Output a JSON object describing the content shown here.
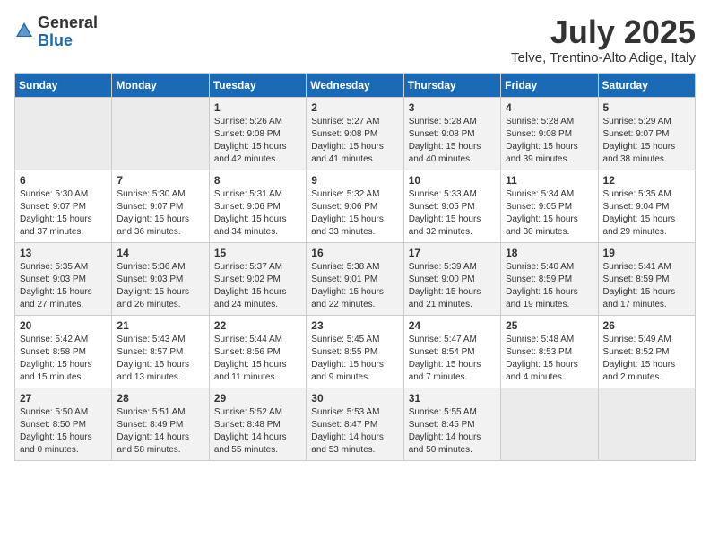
{
  "logo": {
    "text_general": "General",
    "text_blue": "Blue"
  },
  "header": {
    "month": "July 2025",
    "location": "Telve, Trentino-Alto Adige, Italy"
  },
  "weekdays": [
    "Sunday",
    "Monday",
    "Tuesday",
    "Wednesday",
    "Thursday",
    "Friday",
    "Saturday"
  ],
  "weeks": [
    [
      {
        "day": "",
        "info": ""
      },
      {
        "day": "",
        "info": ""
      },
      {
        "day": "1",
        "info": "Sunrise: 5:26 AM\nSunset: 9:08 PM\nDaylight: 15 hours\nand 42 minutes."
      },
      {
        "day": "2",
        "info": "Sunrise: 5:27 AM\nSunset: 9:08 PM\nDaylight: 15 hours\nand 41 minutes."
      },
      {
        "day": "3",
        "info": "Sunrise: 5:28 AM\nSunset: 9:08 PM\nDaylight: 15 hours\nand 40 minutes."
      },
      {
        "day": "4",
        "info": "Sunrise: 5:28 AM\nSunset: 9:08 PM\nDaylight: 15 hours\nand 39 minutes."
      },
      {
        "day": "5",
        "info": "Sunrise: 5:29 AM\nSunset: 9:07 PM\nDaylight: 15 hours\nand 38 minutes."
      }
    ],
    [
      {
        "day": "6",
        "info": "Sunrise: 5:30 AM\nSunset: 9:07 PM\nDaylight: 15 hours\nand 37 minutes."
      },
      {
        "day": "7",
        "info": "Sunrise: 5:30 AM\nSunset: 9:07 PM\nDaylight: 15 hours\nand 36 minutes."
      },
      {
        "day": "8",
        "info": "Sunrise: 5:31 AM\nSunset: 9:06 PM\nDaylight: 15 hours\nand 34 minutes."
      },
      {
        "day": "9",
        "info": "Sunrise: 5:32 AM\nSunset: 9:06 PM\nDaylight: 15 hours\nand 33 minutes."
      },
      {
        "day": "10",
        "info": "Sunrise: 5:33 AM\nSunset: 9:05 PM\nDaylight: 15 hours\nand 32 minutes."
      },
      {
        "day": "11",
        "info": "Sunrise: 5:34 AM\nSunset: 9:05 PM\nDaylight: 15 hours\nand 30 minutes."
      },
      {
        "day": "12",
        "info": "Sunrise: 5:35 AM\nSunset: 9:04 PM\nDaylight: 15 hours\nand 29 minutes."
      }
    ],
    [
      {
        "day": "13",
        "info": "Sunrise: 5:35 AM\nSunset: 9:03 PM\nDaylight: 15 hours\nand 27 minutes."
      },
      {
        "day": "14",
        "info": "Sunrise: 5:36 AM\nSunset: 9:03 PM\nDaylight: 15 hours\nand 26 minutes."
      },
      {
        "day": "15",
        "info": "Sunrise: 5:37 AM\nSunset: 9:02 PM\nDaylight: 15 hours\nand 24 minutes."
      },
      {
        "day": "16",
        "info": "Sunrise: 5:38 AM\nSunset: 9:01 PM\nDaylight: 15 hours\nand 22 minutes."
      },
      {
        "day": "17",
        "info": "Sunrise: 5:39 AM\nSunset: 9:00 PM\nDaylight: 15 hours\nand 21 minutes."
      },
      {
        "day": "18",
        "info": "Sunrise: 5:40 AM\nSunset: 8:59 PM\nDaylight: 15 hours\nand 19 minutes."
      },
      {
        "day": "19",
        "info": "Sunrise: 5:41 AM\nSunset: 8:59 PM\nDaylight: 15 hours\nand 17 minutes."
      }
    ],
    [
      {
        "day": "20",
        "info": "Sunrise: 5:42 AM\nSunset: 8:58 PM\nDaylight: 15 hours\nand 15 minutes."
      },
      {
        "day": "21",
        "info": "Sunrise: 5:43 AM\nSunset: 8:57 PM\nDaylight: 15 hours\nand 13 minutes."
      },
      {
        "day": "22",
        "info": "Sunrise: 5:44 AM\nSunset: 8:56 PM\nDaylight: 15 hours\nand 11 minutes."
      },
      {
        "day": "23",
        "info": "Sunrise: 5:45 AM\nSunset: 8:55 PM\nDaylight: 15 hours\nand 9 minutes."
      },
      {
        "day": "24",
        "info": "Sunrise: 5:47 AM\nSunset: 8:54 PM\nDaylight: 15 hours\nand 7 minutes."
      },
      {
        "day": "25",
        "info": "Sunrise: 5:48 AM\nSunset: 8:53 PM\nDaylight: 15 hours\nand 4 minutes."
      },
      {
        "day": "26",
        "info": "Sunrise: 5:49 AM\nSunset: 8:52 PM\nDaylight: 15 hours\nand 2 minutes."
      }
    ],
    [
      {
        "day": "27",
        "info": "Sunrise: 5:50 AM\nSunset: 8:50 PM\nDaylight: 15 hours\nand 0 minutes."
      },
      {
        "day": "28",
        "info": "Sunrise: 5:51 AM\nSunset: 8:49 PM\nDaylight: 14 hours\nand 58 minutes."
      },
      {
        "day": "29",
        "info": "Sunrise: 5:52 AM\nSunset: 8:48 PM\nDaylight: 14 hours\nand 55 minutes."
      },
      {
        "day": "30",
        "info": "Sunrise: 5:53 AM\nSunset: 8:47 PM\nDaylight: 14 hours\nand 53 minutes."
      },
      {
        "day": "31",
        "info": "Sunrise: 5:55 AM\nSunset: 8:45 PM\nDaylight: 14 hours\nand 50 minutes."
      },
      {
        "day": "",
        "info": ""
      },
      {
        "day": "",
        "info": ""
      }
    ]
  ]
}
